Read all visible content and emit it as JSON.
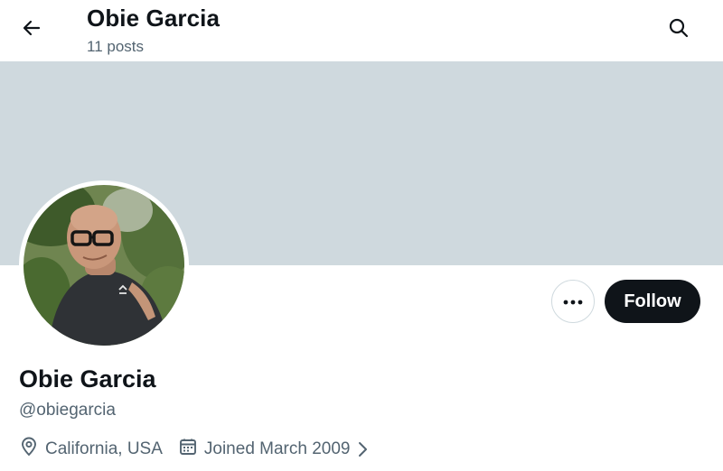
{
  "header": {
    "title": "Obie Garcia",
    "posts_count": "11 posts",
    "back_icon": "arrow-left-icon",
    "search_icon": "search-icon"
  },
  "profile": {
    "display_name": "Obie Garcia",
    "handle": "@obiegarcia",
    "location": "California, USA",
    "joined": "Joined March 2009"
  },
  "actions": {
    "more_icon": "more-horizontal-icon",
    "follow_label": "Follow"
  },
  "colors": {
    "banner": "#cfd9de",
    "text_primary": "#0f1419",
    "text_secondary": "#536471",
    "follow_bg": "#0f1419",
    "border": "#cfd9de"
  }
}
